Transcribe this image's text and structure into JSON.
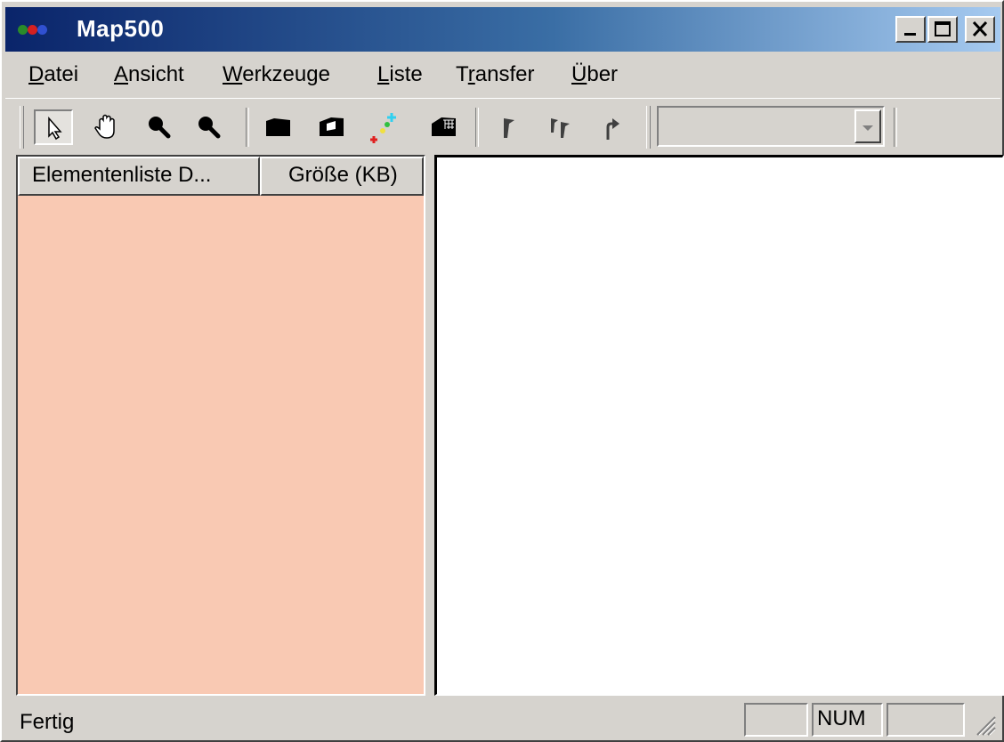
{
  "window": {
    "title": "Map500",
    "icon": "three-dots-app-icon",
    "controls": [
      "minimize",
      "maximize",
      "close"
    ]
  },
  "menu": {
    "items": [
      {
        "label": "Datei",
        "accel": "D"
      },
      {
        "label": "Ansicht",
        "accel": "A"
      },
      {
        "label": "Werkzeuge",
        "accel": "W"
      },
      {
        "label": "Liste",
        "accel": "L"
      },
      {
        "label": "Transfer",
        "accel": "r"
      },
      {
        "label": "Über",
        "accel": "Ü"
      }
    ]
  },
  "toolbar": {
    "tools": [
      {
        "name": "pointer-tool-icon",
        "pressed": true
      },
      {
        "name": "hand-pan-icon",
        "pressed": false
      },
      {
        "name": "zoom-in-icon",
        "pressed": false
      },
      {
        "name": "zoom-out-icon",
        "pressed": false
      },
      {
        "name": "map-block-icon",
        "pressed": false
      },
      {
        "name": "map-fold-icon",
        "pressed": false
      },
      {
        "name": "add-color-icon",
        "pressed": false
      },
      {
        "name": "map-grid-icon",
        "pressed": false
      },
      {
        "name": "flag-icon",
        "pressed": false
      },
      {
        "name": "flags-icon",
        "pressed": false
      },
      {
        "name": "route-arrow-icon",
        "pressed": false
      }
    ],
    "combo_value": ""
  },
  "list": {
    "columns": [
      "Elementenliste D...",
      "Größe (KB)"
    ],
    "rows": []
  },
  "status": {
    "text": "Fertig",
    "panes": [
      "",
      "NUM",
      ""
    ]
  },
  "colors": {
    "title_start": "#0a246a",
    "title_end": "#a6caf0",
    "list_bg": "#f9c9b3",
    "face": "#d6d3ce"
  }
}
